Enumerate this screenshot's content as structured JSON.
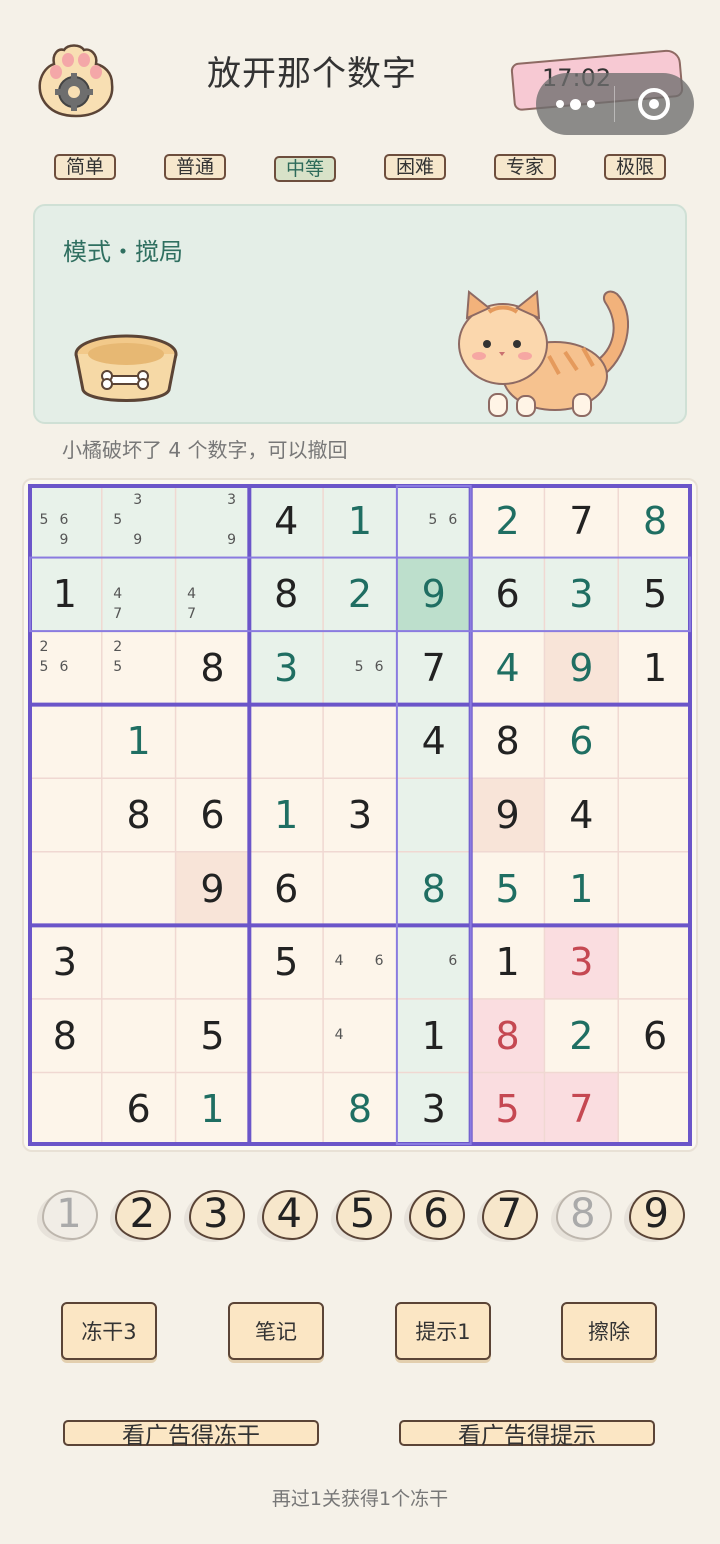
{
  "header": {
    "title": "放开那个数字",
    "time": "17:02"
  },
  "tabs": [
    {
      "label": "简单",
      "active": false
    },
    {
      "label": "普通",
      "active": false
    },
    {
      "label": "中等",
      "active": true
    },
    {
      "label": "困难",
      "active": false
    },
    {
      "label": "专家",
      "active": false
    },
    {
      "label": "极限",
      "active": false
    }
  ],
  "mode": {
    "label": "模式・搅局",
    "info": "小橘破坏了 4 个数字，可以撤回"
  },
  "board": {
    "cells": [
      [
        {
          "v": "",
          "n": [
            "",
            "",
            "",
            "5",
            "6",
            "",
            "",
            "9",
            ""
          ],
          "bg": "hl"
        },
        {
          "v": "",
          "n": [
            "",
            "3",
            "",
            "5",
            "",
            "",
            "",
            "9",
            ""
          ],
          "bg": "hl"
        },
        {
          "v": "",
          "n": [
            "",
            "",
            "3",
            "",
            "",
            "",
            "",
            "",
            "9"
          ],
          "bg": "hl"
        },
        {
          "v": "4",
          "t": "given",
          "bg": "hl"
        },
        {
          "v": "1",
          "t": "user",
          "bg": "hl"
        },
        {
          "v": "",
          "n": [
            "",
            "",
            "",
            "",
            "5",
            "6",
            "",
            "",
            ""
          ],
          "bg": "hl"
        },
        {
          "v": "2",
          "t": "user",
          "bg": ""
        },
        {
          "v": "7",
          "t": "given",
          "bg": ""
        },
        {
          "v": "8",
          "t": "user",
          "bg": ""
        }
      ],
      [
        {
          "v": "1",
          "t": "given",
          "bg": "hl"
        },
        {
          "v": "",
          "n": [
            "",
            "",
            "",
            "4",
            "",
            "",
            "7",
            "",
            ""
          ],
          "bg": "hl"
        },
        {
          "v": "",
          "n": [
            "",
            "",
            "",
            "4",
            "",
            "",
            "7",
            "",
            ""
          ],
          "bg": "hl"
        },
        {
          "v": "8",
          "t": "given",
          "bg": "hl"
        },
        {
          "v": "2",
          "t": "user",
          "bg": "hl"
        },
        {
          "v": "9",
          "t": "user",
          "bg": "sel"
        },
        {
          "v": "6",
          "t": "given",
          "bg": "hl"
        },
        {
          "v": "3",
          "t": "user",
          "bg": "hl"
        },
        {
          "v": "5",
          "t": "given",
          "bg": "hl"
        }
      ],
      [
        {
          "v": "",
          "n": [
            "2",
            "",
            "",
            "5",
            "6",
            "",
            "",
            "",
            ""
          ],
          "bg": ""
        },
        {
          "v": "",
          "n": [
            "2",
            "",
            "",
            "5",
            "",
            "",
            "",
            "",
            ""
          ],
          "bg": ""
        },
        {
          "v": "8",
          "t": "given",
          "bg": ""
        },
        {
          "v": "3",
          "t": "user",
          "bg": "hl"
        },
        {
          "v": "",
          "n": [
            "",
            "",
            "",
            "",
            "5",
            "6",
            "",
            "",
            ""
          ],
          "bg": "hl"
        },
        {
          "v": "7",
          "t": "given",
          "bg": "hl"
        },
        {
          "v": "4",
          "t": "user",
          "bg": ""
        },
        {
          "v": "9",
          "t": "user",
          "bg": "same"
        },
        {
          "v": "1",
          "t": "given",
          "bg": ""
        }
      ],
      [
        {
          "v": "",
          "bg": ""
        },
        {
          "v": "1",
          "t": "user",
          "bg": ""
        },
        {
          "v": "",
          "bg": ""
        },
        {
          "v": "",
          "bg": ""
        },
        {
          "v": "",
          "bg": ""
        },
        {
          "v": "4",
          "t": "given",
          "bg": "hl"
        },
        {
          "v": "8",
          "t": "given",
          "bg": ""
        },
        {
          "v": "6",
          "t": "user",
          "bg": ""
        },
        {
          "v": "",
          "bg": ""
        }
      ],
      [
        {
          "v": "",
          "bg": ""
        },
        {
          "v": "8",
          "t": "given",
          "bg": ""
        },
        {
          "v": "6",
          "t": "given",
          "bg": ""
        },
        {
          "v": "1",
          "t": "user",
          "bg": ""
        },
        {
          "v": "3",
          "t": "given",
          "bg": ""
        },
        {
          "v": "",
          "bg": "hl"
        },
        {
          "v": "9",
          "t": "given",
          "bg": "same"
        },
        {
          "v": "4",
          "t": "given",
          "bg": ""
        },
        {
          "v": "",
          "bg": ""
        }
      ],
      [
        {
          "v": "",
          "bg": ""
        },
        {
          "v": "",
          "bg": ""
        },
        {
          "v": "9",
          "t": "given",
          "bg": "same"
        },
        {
          "v": "6",
          "t": "given",
          "bg": ""
        },
        {
          "v": "",
          "bg": ""
        },
        {
          "v": "8",
          "t": "user",
          "bg": "hl"
        },
        {
          "v": "5",
          "t": "user",
          "bg": ""
        },
        {
          "v": "1",
          "t": "user",
          "bg": ""
        },
        {
          "v": "",
          "bg": ""
        }
      ],
      [
        {
          "v": "3",
          "t": "given",
          "bg": ""
        },
        {
          "v": "",
          "bg": ""
        },
        {
          "v": "",
          "bg": ""
        },
        {
          "v": "5",
          "t": "given",
          "bg": ""
        },
        {
          "v": "",
          "n": [
            "",
            "",
            "",
            "4",
            "",
            "6",
            "",
            "",
            ""
          ],
          "bg": ""
        },
        {
          "v": "",
          "n": [
            "",
            "",
            "",
            "",
            "",
            "6",
            "",
            "",
            ""
          ],
          "bg": "hl"
        },
        {
          "v": "1",
          "t": "given",
          "bg": ""
        },
        {
          "v": "3",
          "t": "wrong",
          "bg": "err"
        },
        {
          "v": "",
          "bg": ""
        }
      ],
      [
        {
          "v": "8",
          "t": "given",
          "bg": ""
        },
        {
          "v": "",
          "bg": ""
        },
        {
          "v": "5",
          "t": "given",
          "bg": ""
        },
        {
          "v": "",
          "bg": ""
        },
        {
          "v": "",
          "n": [
            "",
            "",
            "",
            "4",
            "",
            "",
            "",
            "",
            ""
          ],
          "bg": ""
        },
        {
          "v": "1",
          "t": "given",
          "bg": "hl"
        },
        {
          "v": "8",
          "t": "wrong",
          "bg": "err"
        },
        {
          "v": "2",
          "t": "user",
          "bg": ""
        },
        {
          "v": "6",
          "t": "given",
          "bg": ""
        }
      ],
      [
        {
          "v": "",
          "bg": ""
        },
        {
          "v": "6",
          "t": "given",
          "bg": ""
        },
        {
          "v": "1",
          "t": "user",
          "bg": ""
        },
        {
          "v": "",
          "bg": ""
        },
        {
          "v": "8",
          "t": "user",
          "bg": ""
        },
        {
          "v": "3",
          "t": "given",
          "bg": "hl"
        },
        {
          "v": "5",
          "t": "wrong",
          "bg": "err"
        },
        {
          "v": "7",
          "t": "wrong",
          "bg": "err"
        },
        {
          "v": "",
          "bg": ""
        }
      ]
    ]
  },
  "numpad": [
    {
      "label": "1",
      "dim": true
    },
    {
      "label": "2",
      "dim": false
    },
    {
      "label": "3",
      "dim": false
    },
    {
      "label": "4",
      "dim": false
    },
    {
      "label": "5",
      "dim": false
    },
    {
      "label": "6",
      "dim": false
    },
    {
      "label": "7",
      "dim": false
    },
    {
      "label": "8",
      "dim": true
    },
    {
      "label": "9",
      "dim": false
    }
  ],
  "actions": {
    "freeze": "冻干3",
    "notes": "笔记",
    "hint": "提示1",
    "erase": "擦除"
  },
  "ads": {
    "freeze": "看广告得冻干",
    "hint": "看广告得提示"
  },
  "footer": "再过1关获得1个冻干",
  "colors": {
    "accent_purple": "#6b55c9",
    "user_green": "#1f6e62",
    "error_red": "#c54852"
  }
}
